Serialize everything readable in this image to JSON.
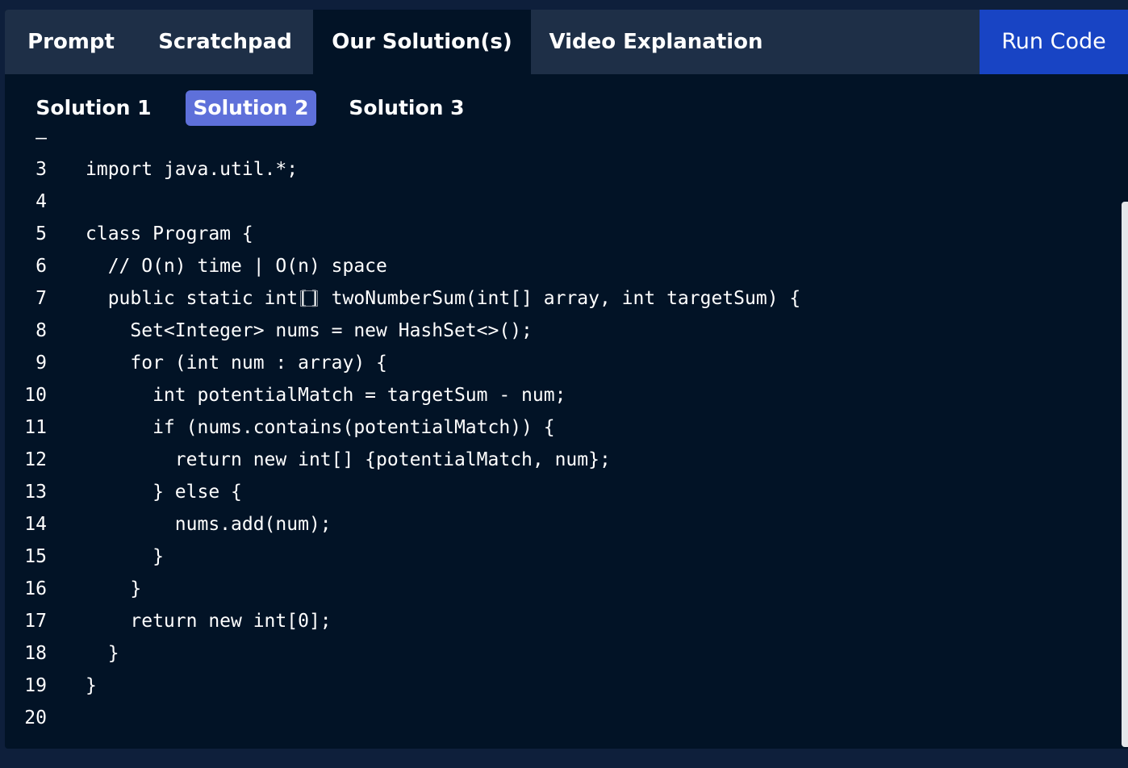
{
  "tabs": [
    {
      "label": "Prompt",
      "active": false
    },
    {
      "label": "Scratchpad",
      "active": false
    },
    {
      "label": "Our Solution(s)",
      "active": true
    },
    {
      "label": "Video Explanation",
      "active": false
    }
  ],
  "run_button": {
    "label": "Run Code"
  },
  "solutions": [
    {
      "label": "Solution 1",
      "active": false
    },
    {
      "label": "Solution 2",
      "active": true
    },
    {
      "label": "Solution 3",
      "active": false
    }
  ],
  "editor": {
    "partial_line_marker": "–",
    "lines": [
      {
        "no": "3",
        "text": "import java.util.*;"
      },
      {
        "no": "4",
        "text": ""
      },
      {
        "no": "5",
        "text": "class Program {"
      },
      {
        "no": "6",
        "text": "  // O(n) time | O(n) space"
      },
      {
        "no": "7",
        "text_before": "  public static int",
        "highlight": "[]",
        "text_after": " twoNumberSum(int[] array, int targetSum) {"
      },
      {
        "no": "8",
        "text": "    Set<Integer> nums = new HashSet<>();"
      },
      {
        "no": "9",
        "text": "    for (int num : array) {"
      },
      {
        "no": "10",
        "text": "      int potentialMatch = targetSum - num;"
      },
      {
        "no": "11",
        "text": "      if (nums.contains(potentialMatch)) {"
      },
      {
        "no": "12",
        "text": "        return new int[] {potentialMatch, num};"
      },
      {
        "no": "13",
        "text": "      } else {"
      },
      {
        "no": "14",
        "text": "        nums.add(num);"
      },
      {
        "no": "15",
        "text": "      }"
      },
      {
        "no": "16",
        "text": "    }"
      },
      {
        "no": "17",
        "text": "    return new int[0];"
      },
      {
        "no": "18",
        "text": "  }"
      },
      {
        "no": "19",
        "text": "}"
      },
      {
        "no": "20",
        "text": ""
      }
    ]
  },
  "colors": {
    "background": "#0e1f3b",
    "panel": "#021326",
    "tabbar": "#1e2f47",
    "run_button": "#1844c4",
    "active_solution": "#5e70da"
  }
}
